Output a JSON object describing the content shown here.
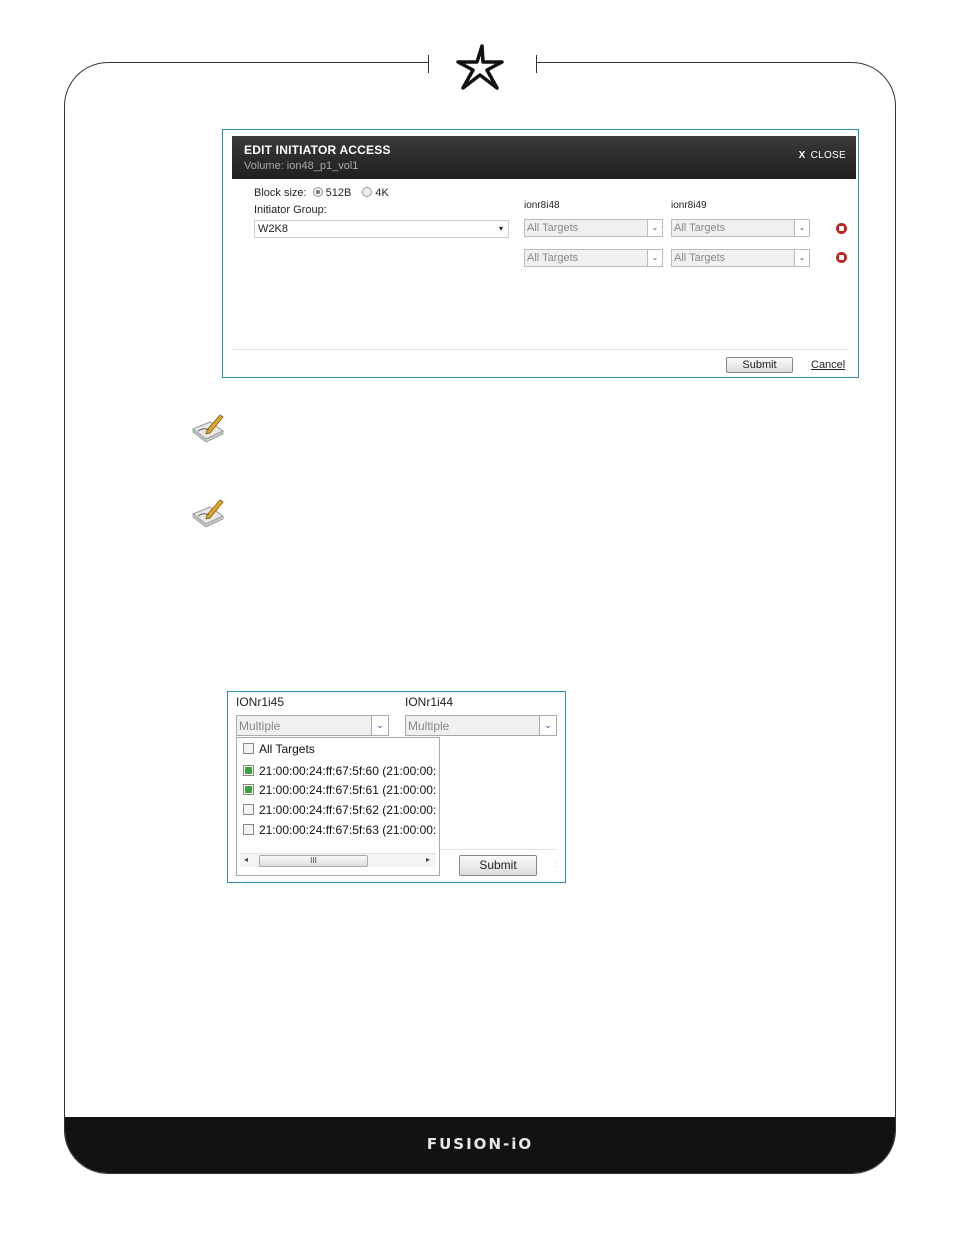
{
  "brand": {
    "footer": "FUSION-iO"
  },
  "dialog": {
    "title": "EDIT INITIATOR ACCESS",
    "subtitle": "Volume: ion48_p1_vol1",
    "close_x": "X",
    "close_label": "CLOSE",
    "block_size_label": "Block size:",
    "block_size_options": [
      "512B",
      "4K"
    ],
    "block_size_selected": "512B",
    "initiator_group_label": "Initiator Group:",
    "initiator_group_value": "W2K8",
    "columns": [
      "ionr8i48",
      "ionr8i49"
    ],
    "rows": [
      [
        "All Targets",
        "All Targets"
      ],
      [
        "All Targets",
        "All Targets"
      ]
    ],
    "submit_label": "Submit",
    "cancel_label": "Cancel"
  },
  "dropdown_view": {
    "columns": [
      "IONr1i45",
      "IONr1i44"
    ],
    "selects": [
      "Multiple",
      "Multiple"
    ],
    "options": [
      {
        "label": "All Targets",
        "checked": false
      },
      {
        "label": "21:00:00:24:ff:67:5f:60 (21:00:00:",
        "checked": true
      },
      {
        "label": "21:00:00:24:ff:67:5f:61 (21:00:00:",
        "checked": true
      },
      {
        "label": "21:00:00:24:ff:67:5f:62 (21:00:00:",
        "checked": false
      },
      {
        "label": "21:00:00:24:ff:67:5f:63 (21:00:00:",
        "checked": false
      }
    ],
    "scroll_left": "◂",
    "scroll_grip": "III",
    "scroll_right": "▸",
    "submit_label": "Submit"
  },
  "icons": {
    "dropdown_arrow": "▾",
    "select_button": "⌄",
    "logo": "star-logo-icon",
    "note": "note-pencil-icon",
    "delete": "delete-icon"
  }
}
